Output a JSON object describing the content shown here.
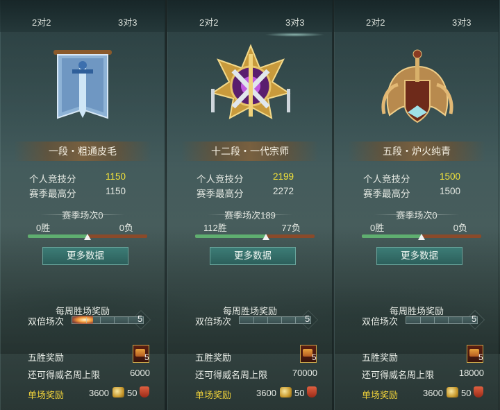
{
  "tabs": {
    "t1": "2对2",
    "t2": "3对3"
  },
  "labels": {
    "personal_score": "个人竞技分",
    "season_high": "赛季最高分",
    "more_data": "更多数据",
    "weekly_reward": "每周胜场奖励",
    "double_matches": "双倍场次",
    "double_count": "5",
    "five_win_reward": "五胜奖励",
    "chest_count": "5",
    "weekly_cap": "还可得威名周上限",
    "single_reward": "单场奖励",
    "single_coin": "3600",
    "single_fame": "50"
  },
  "panels": [
    {
      "rank": "一段・粗通皮毛",
      "score": "1150",
      "season_high": "1150",
      "season_matches": "赛季场次0",
      "wins": "0胜",
      "losses": "0负",
      "win_fraction": 0.5,
      "weekly_cap": "6000",
      "active_tab": "t1"
    },
    {
      "rank": "十二段・一代宗师",
      "score": "2199",
      "season_high": "2272",
      "season_matches": "赛季场次189",
      "wins": "112胜",
      "losses": "77负",
      "win_fraction": 0.593,
      "weekly_cap": "70000",
      "active_tab": "t2"
    },
    {
      "rank": "五段・炉火纯青",
      "score": "1500",
      "season_high": "1500",
      "season_matches": "赛季场次0",
      "wins": "0胜",
      "losses": "0负",
      "win_fraction": 0.5,
      "weekly_cap": "18000",
      "active_tab": "t1"
    }
  ],
  "colors": {
    "score": "#f3e33a",
    "single_reward": "#f0d33a",
    "win": "#5fae70",
    "loss": "#8a4a2a"
  },
  "icons": [
    "banner-sword-emblem",
    "grandmaster-emblem",
    "wings-shield-emblem",
    "treasure-chest-icon",
    "coin-icon",
    "fame-shield-icon"
  ]
}
